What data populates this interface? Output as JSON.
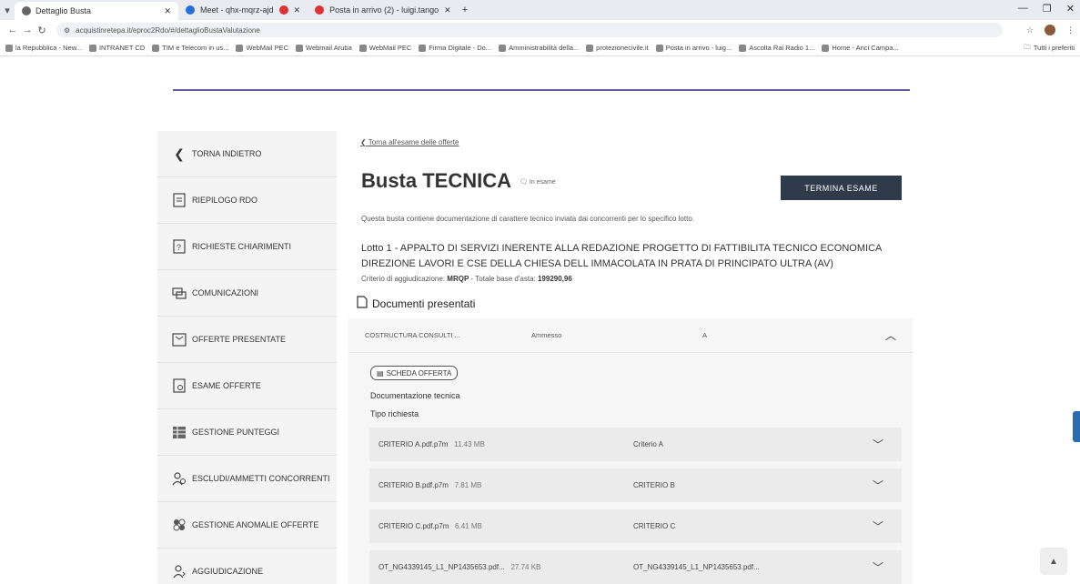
{
  "browser": {
    "tabs": [
      {
        "label": "Dettaglio Busta",
        "active": true
      },
      {
        "label": "Meet - qhx-mqrz-ajd",
        "active": false
      },
      {
        "label": "Posta in arrivo (2) - luigi.tango",
        "active": false
      }
    ],
    "url": "acquistinretepa.it/eproc2Rdo/#/dettaglioBustaValutazione",
    "bookmarks": [
      "la Repubblica - New...",
      "INTRANET CD",
      "TIM e Telecom in us...",
      "WebMail PEC",
      "Webmail Aruba",
      "WebMail PEC",
      "Firma Digitale - Do...",
      "Amministrabilità della...",
      "protezionecivile.it",
      "Posta in arrivo - luig...",
      "Ascolta Rai Radio 1...",
      "Home - Anci Campa..."
    ],
    "bookmarks_right": "Tutti i preferiti"
  },
  "sidebar": {
    "back_label": "TORNA INDIETRO",
    "items": [
      {
        "label": "RIEPILOGO RDO",
        "icon": "clipboard-icon"
      },
      {
        "label": "RICHIESTE CHIARIMENTI",
        "icon": "question-doc-icon"
      },
      {
        "label": "COMUNICAZIONI",
        "icon": "chat-icon"
      },
      {
        "label": "OFFERTE PRESENTATE",
        "icon": "offer-doc-icon"
      },
      {
        "label": "ESAME OFFERTE",
        "icon": "exam-doc-icon"
      },
      {
        "label": "GESTIONE PUNTEGGI",
        "icon": "grid-icon"
      },
      {
        "label": "ESCLUDI/AMMETTI CONCORRENTI",
        "icon": "users-icon"
      },
      {
        "label": "GESTIONE ANOMALIE OFFERTE",
        "icon": "anomaly-icon"
      },
      {
        "label": "AGGIUDICAZIONE",
        "icon": "award-icon"
      }
    ]
  },
  "main": {
    "backlink": "Torna all'esame delle offerte",
    "title": "Busta TECNICA",
    "status": "In esame",
    "termina_label": "TERMINA ESAME",
    "description": "Questa busta contiene documentazione di carattere tecnico inviata dai concorrenti per lo specifico lotto.",
    "lotto": "Lotto 1 - APPALTO DI SERVIZI INERENTE ALLA REDAZIONE PROGETTO DI FATTIBILITA TECNICO ECONOMICA DIREZIONE LAVORI E CSE DELLA CHIESA DELL IMMACOLATA IN PRATA DI PRINCIPATO ULTRA (AV)",
    "criterio_label": "Criterio di aggiudicazione:",
    "criterio_value": "MRQP",
    "base_label": "- Totale base d'asta:",
    "base_value": "199290,96",
    "docs_title": "Documenti presentati",
    "offer": {
      "company": "COSTRUCTURA CONSULTI ...",
      "status": "Ammesso",
      "code": "A"
    },
    "scheda_label": "SCHEDA OFFERTA",
    "doc_tecnica": "Documentazione tecnica",
    "tipo_richiesta": "Tipo richiesta",
    "files": [
      {
        "name": "CRITERIO A.pdf.p7m",
        "size": "11.43 MB",
        "criterio": "Criterio A"
      },
      {
        "name": "CRITERIO B.pdf.p7m",
        "size": "7.81 MB",
        "criterio": "CRITERIO B"
      },
      {
        "name": "CRITERIO C.pdf.p7m",
        "size": "6.41 MB",
        "criterio": "CRITERIO C"
      },
      {
        "name": "OT_NG4339145_L1_NP1435653.pdf...",
        "size": "27.74 KB",
        "criterio": "OT_NG4339145_L1_NP1435653.pdf..."
      }
    ]
  },
  "colors": {
    "accent_purple": "#6c5b9e",
    "button_dark": "#2f3a4a",
    "sidebar_bg": "#f4f4f4"
  }
}
